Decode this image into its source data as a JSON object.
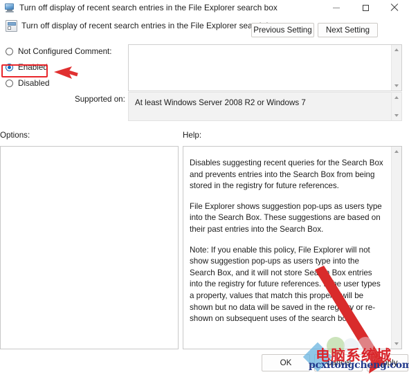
{
  "window": {
    "title": "Turn off display of recent search entries in the File Explorer search box",
    "icon": "monitor-icon",
    "controls": {
      "minimize": "minimize-icon",
      "maximize": "maximize-icon",
      "close": "close-icon"
    }
  },
  "setting_header": {
    "icon": "policy-setting-icon",
    "title": "Turn off display of recent search entries in the File Explorer search box",
    "previous_button": "Previous Setting",
    "next_button": "Next Setting"
  },
  "state_options": [
    {
      "label": "Not Configured",
      "selected": false
    },
    {
      "label": "Enabled",
      "selected": true
    },
    {
      "label": "Disabled",
      "selected": false
    }
  ],
  "comment": {
    "label": "Comment:",
    "value": "",
    "placeholder": ""
  },
  "supported_on": {
    "label": "Supported on:",
    "value": "At least Windows Server 2008 R2 or Windows 7"
  },
  "options": {
    "label": "Options:",
    "items": []
  },
  "help": {
    "label": "Help:",
    "paragraphs": [
      "Disables suggesting recent queries for the Search Box and prevents entries into the Search Box from being stored in the registry for future references.",
      "File Explorer shows suggestion pop-ups as users type into the Search Box.  These suggestions are based on their past entries into the Search Box.",
      "Note: If you enable this policy, File Explorer will not show suggestion pop-ups as users type into the Search Box, and it will not store Search Box entries into the registry for future references.  If the user types a property, values that match this property will be shown but no data will be saved in the registry or re-shown on subsequent uses of the search box."
    ]
  },
  "footer": {
    "ok": "OK",
    "cancel": "Cancel",
    "apply": "Apply"
  },
  "annotations": {
    "highlight_target": "Enabled",
    "highlight_color": "#e8262b",
    "arrow_color": "#e03030"
  },
  "watermark": {
    "chinese": "电脑系统城",
    "domain": "pcxitongcheng.com"
  }
}
